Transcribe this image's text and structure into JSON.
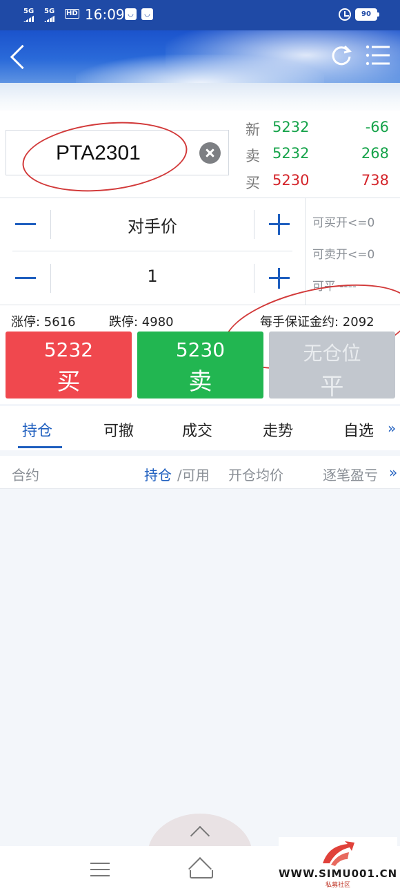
{
  "status_bar": {
    "sim1": "5G",
    "sim2": "5G",
    "hd": "HD",
    "time": "16:09",
    "battery": "90"
  },
  "header": {
    "back_icon": "chevron-left-icon",
    "refresh_icon": "refresh-icon",
    "menu_icon": "list-menu-icon"
  },
  "symbol": {
    "value": "PTA2301"
  },
  "quote": [
    {
      "label": "新",
      "price": "5232",
      "volume": "-66",
      "price_color": "green",
      "volume_color": "green"
    },
    {
      "label": "卖",
      "price": "5232",
      "volume": "268",
      "price_color": "green",
      "volume_color": "green"
    },
    {
      "label": "买",
      "price": "5230",
      "volume": "738",
      "price_color": "red",
      "volume_color": "red"
    }
  ],
  "price_control": {
    "value": "对手价"
  },
  "qty_control": {
    "value": "1"
  },
  "side_info": {
    "buy_open": "可买开<=0",
    "sell_open": "可卖开<=0",
    "close": "可平 ----"
  },
  "limits": {
    "up": "涨停: 5616",
    "down": "跌停: 4980",
    "margin": "每手保证金约: 2092"
  },
  "buttons": {
    "buy_price": "5232",
    "buy_action": "买",
    "sell_price": "5230",
    "sell_action": "卖",
    "close_price": "无仓位",
    "close_action": "平"
  },
  "tabs": [
    "持仓",
    "可撤",
    "成交",
    "走势",
    "自选"
  ],
  "tabs_more": "»",
  "columns": {
    "contract": "合约",
    "position": "持仓",
    "slash_available": "/可用",
    "avg_price": "开仓均价",
    "pnl": "逐笔盈亏",
    "more": "»"
  },
  "watermark": {
    "url": "WWW.SIMU001.CN",
    "sub": "私募社区"
  },
  "colors": {
    "brand_blue": "#1f5fbf",
    "buy_red": "#f0484e",
    "sell_green": "#22b651",
    "disabled_gray": "#c2c7ce",
    "annotation_red": "#d23a3a"
  }
}
